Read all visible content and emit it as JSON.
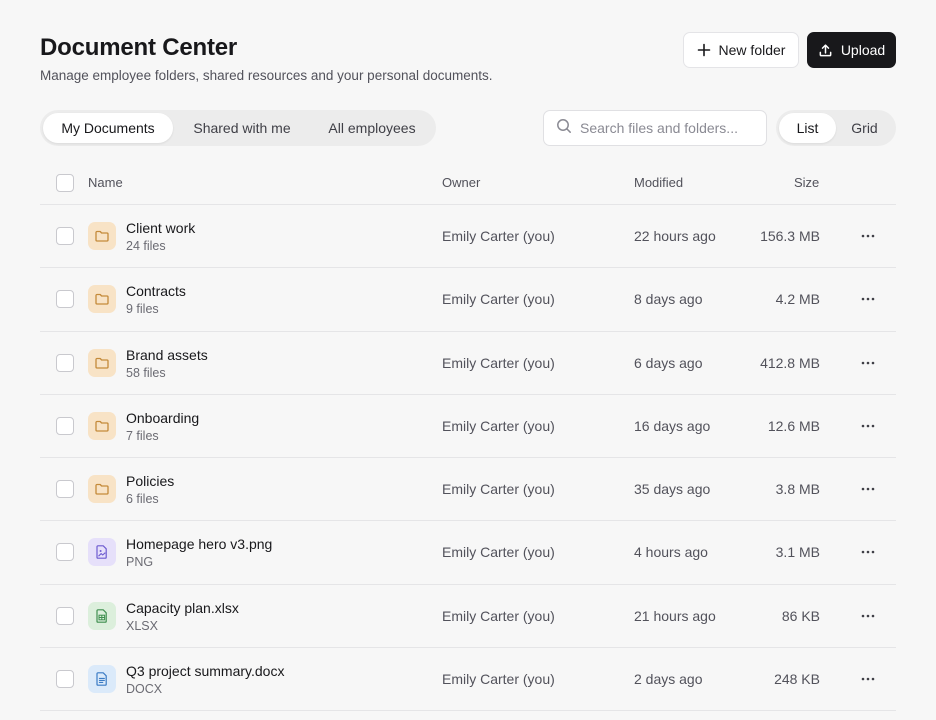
{
  "header": {
    "title": "Document Center",
    "subtitle": "Manage employee folders, shared resources and your personal documents.",
    "new_folder_label": "New folder",
    "upload_label": "Upload"
  },
  "tabs": [
    {
      "label": "My Documents",
      "active": true
    },
    {
      "label": "Shared with me",
      "active": false
    },
    {
      "label": "All employees",
      "active": false
    }
  ],
  "search": {
    "placeholder": "Search files and folders..."
  },
  "view_toggle": [
    {
      "label": "List",
      "active": true
    },
    {
      "label": "Grid",
      "active": false
    }
  ],
  "table": {
    "columns": {
      "name": "Name",
      "owner": "Owner",
      "modified": "Modified",
      "size": "Size"
    },
    "rows": [
      {
        "name": "Client work",
        "sub": "24 files",
        "type": "folder",
        "icon": "folder-icon",
        "owner": "Emily Carter (you)",
        "modified": "22 hours ago",
        "size": "156.3 MB"
      },
      {
        "name": "Contracts",
        "sub": "9 files",
        "type": "folder",
        "icon": "folder-icon",
        "owner": "Emily Carter (you)",
        "modified": "8 days ago",
        "size": "4.2 MB"
      },
      {
        "name": "Brand assets",
        "sub": "58 files",
        "type": "folder",
        "icon": "folder-icon",
        "owner": "Emily Carter (you)",
        "modified": "6 days ago",
        "size": "412.8 MB"
      },
      {
        "name": "Onboarding",
        "sub": "7 files",
        "type": "folder",
        "icon": "folder-icon",
        "owner": "Emily Carter (you)",
        "modified": "16 days ago",
        "size": "12.6 MB"
      },
      {
        "name": "Policies",
        "sub": "6 files",
        "type": "folder",
        "icon": "folder-icon",
        "owner": "Emily Carter (you)",
        "modified": "35 days ago",
        "size": "3.8 MB"
      },
      {
        "name": "Homepage hero v3.png",
        "sub": "PNG",
        "type": "png",
        "icon": "image-file-icon",
        "owner": "Emily Carter (you)",
        "modified": "4 hours ago",
        "size": "3.1 MB"
      },
      {
        "name": "Capacity plan.xlsx",
        "sub": "XLSX",
        "type": "xlsx",
        "icon": "spreadsheet-file-icon",
        "owner": "Emily Carter (you)",
        "modified": "21 hours ago",
        "size": "86 KB"
      },
      {
        "name": "Q3 project summary.docx",
        "sub": "DOCX",
        "type": "docx",
        "icon": "document-file-icon",
        "owner": "Emily Carter (you)",
        "modified": "2 days ago",
        "size": "248 KB"
      }
    ]
  },
  "colors": {
    "background": "#f7f7f7",
    "primary_button": "#18181b",
    "folder_icon": "#c48a3a",
    "png_icon": "#6d5bd0",
    "xlsx_icon": "#3f8f4f",
    "docx_icon": "#3b7bc4"
  }
}
